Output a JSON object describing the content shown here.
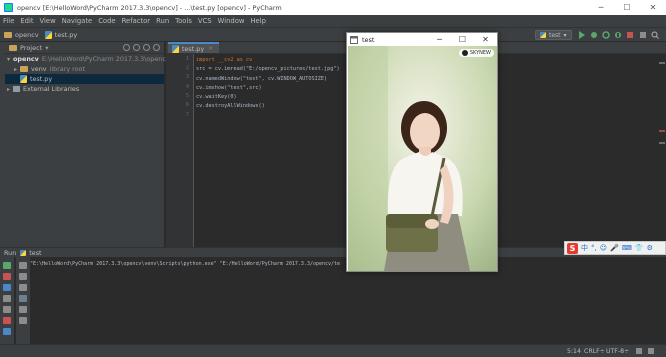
{
  "window": {
    "title": "opencv [E:\\HelloWord\\PyCharm 2017.3.3\\opencv] - ...\\test.py [opencv] - PyCharm",
    "minimize": "─",
    "maximize": "☐",
    "close": "✕"
  },
  "menu": [
    "File",
    "Edit",
    "View",
    "Navigate",
    "Code",
    "Refactor",
    "Run",
    "Tools",
    "VCS",
    "Window",
    "Help"
  ],
  "breadcrumb": {
    "project": "opencv",
    "file": "test.py"
  },
  "toolbar": {
    "run_config": "test"
  },
  "project_panel": {
    "title": "Project",
    "tree": [
      {
        "label": "opencv",
        "detail": "E:\\HelloWord\\PyCharm 2017.3.3\\opencv",
        "arrow": "▾"
      },
      {
        "label": "venv",
        "detail": "library root",
        "arrow": "▸"
      },
      {
        "label": "test.py",
        "detail": "",
        "arrow": ""
      },
      {
        "label": "External Libraries",
        "detail": "",
        "arrow": "▸"
      }
    ]
  },
  "editor": {
    "tab_label": "test.py",
    "tab_close": "×",
    "line_numbers": [
      "1",
      "2",
      "3",
      "4",
      "5",
      "6",
      "7"
    ],
    "code": [
      "import __cv2 as cv",
      "src = cv.imread(\"E:/opencv_pictures/test.jpg\")",
      "cv.namedWindow(\"test\", cv.WINDOW_AUTOSIZE)",
      "cv.imshow(\"test\",src)",
      "cv.waitKey(0)",
      "cv.destroyAllWindows()",
      ""
    ]
  },
  "run_panel": {
    "title": "Run",
    "config": "test",
    "output": "\"E:\\HelloWord\\PyCharm 2017.3.3\\opencv\\venv\\Scripts\\python.exe\" \"E:/HelloWord/PyCharm 2017.3.3/opencv/te"
  },
  "status_bar": {
    "position": "5:14",
    "line_sep": "CRLF÷",
    "encoding": "UTF-8÷"
  },
  "ime": {
    "logo": "S",
    "items": [
      "中",
      "°,",
      "☺",
      "🎤",
      "⌨",
      "👕",
      "⚙"
    ]
  },
  "cv_window": {
    "title": "test",
    "minimize": "─",
    "maximize": "☐",
    "close": "✕",
    "watermark": "SKYNEW"
  },
  "colors": {
    "ide_bg": "#2b2b2b",
    "panel_bg": "#3c3f41",
    "selection": "#0d293e",
    "keyword": "#cc7832",
    "string": "#6a8759"
  }
}
